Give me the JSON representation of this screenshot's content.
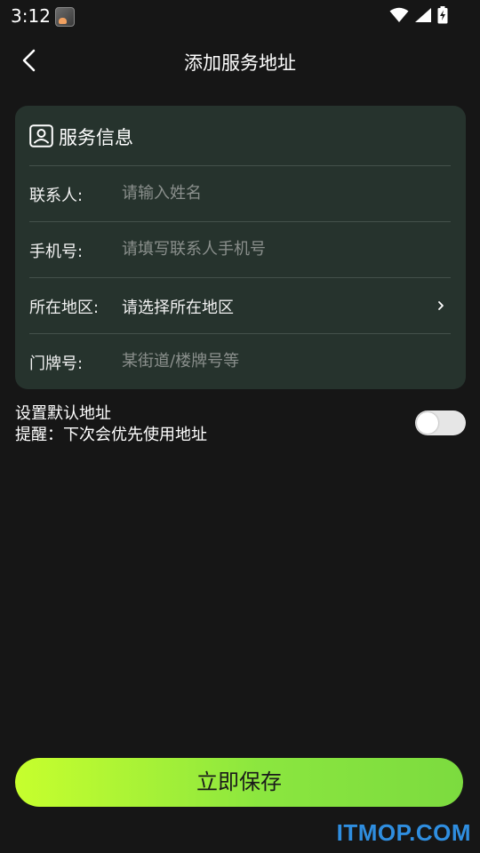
{
  "status_bar": {
    "time": "3:12",
    "icons": [
      "app-notification-icon",
      "wifi-icon",
      "signal-icon",
      "battery-charging-icon"
    ]
  },
  "header": {
    "title": "添加服务地址",
    "back_icon": "back-chevron-icon"
  },
  "card": {
    "title": "服务信息",
    "icon": "contact-card-icon",
    "fields": [
      {
        "label": "联系人:",
        "placeholder": "请输入姓名",
        "value": ""
      },
      {
        "label": "手机号:",
        "placeholder": "请填写联系人手机号",
        "value": ""
      },
      {
        "label": "所在地区:",
        "value": "请选择所在地区",
        "icon": "chevron-right-icon"
      },
      {
        "label": "门牌号:",
        "placeholder": "某街道/楼牌号等",
        "value": ""
      }
    ]
  },
  "default_address": {
    "title": "设置默认地址",
    "hint": "提醒：下次会优先使用地址",
    "enabled": false
  },
  "save_button": {
    "label": "立即保存"
  },
  "watermark": "ITMOP.COM",
  "colors": {
    "background": "#161616",
    "card": "#26332d",
    "accent_start": "#c7ff2d",
    "accent_end": "#7cdb3f",
    "placeholder": "#8a8f8c",
    "watermark": "#2f8ee0"
  }
}
